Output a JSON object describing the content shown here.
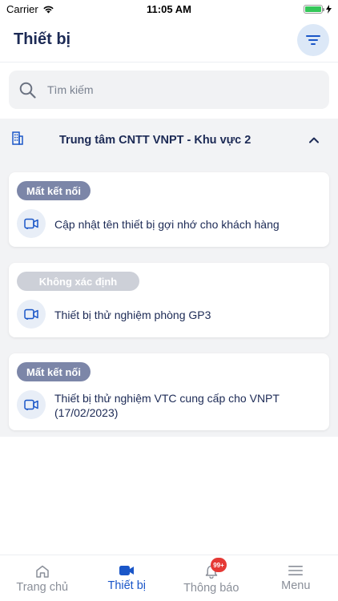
{
  "status_bar": {
    "carrier": "Carrier",
    "time": "11:05 AM"
  },
  "header": {
    "title": "Thiết bị"
  },
  "search": {
    "placeholder": "Tìm kiếm"
  },
  "group": {
    "title": "Trung tâm CNTT VNPT - Khu vực 2"
  },
  "devices": [
    {
      "status": "Mất kết nối",
      "name": "Cập nhật tên thiết bị gợi nhớ cho khách hàng"
    },
    {
      "status": "Không xác định",
      "name": "Thiết bị thử nghiệm phòng GP3"
    },
    {
      "status": "Mất kết nối",
      "name": "Thiết bị thử nghiệm VTC cung cấp cho VNPT (17/02/2023)"
    }
  ],
  "tabs": [
    {
      "label": "Trang chủ",
      "icon": "home-icon"
    },
    {
      "label": "Thiết bị",
      "icon": "camera-icon"
    },
    {
      "label": "Thông báo",
      "icon": "bell-icon",
      "badge": "99+"
    },
    {
      "label": "Menu",
      "icon": "menu-icon"
    }
  ],
  "colors": {
    "accent": "#1a56c8",
    "title": "#1c2a55",
    "badge_offline": "#7c86a8",
    "badge_unknown": "#cdd0d8",
    "notif": "#e53935"
  }
}
